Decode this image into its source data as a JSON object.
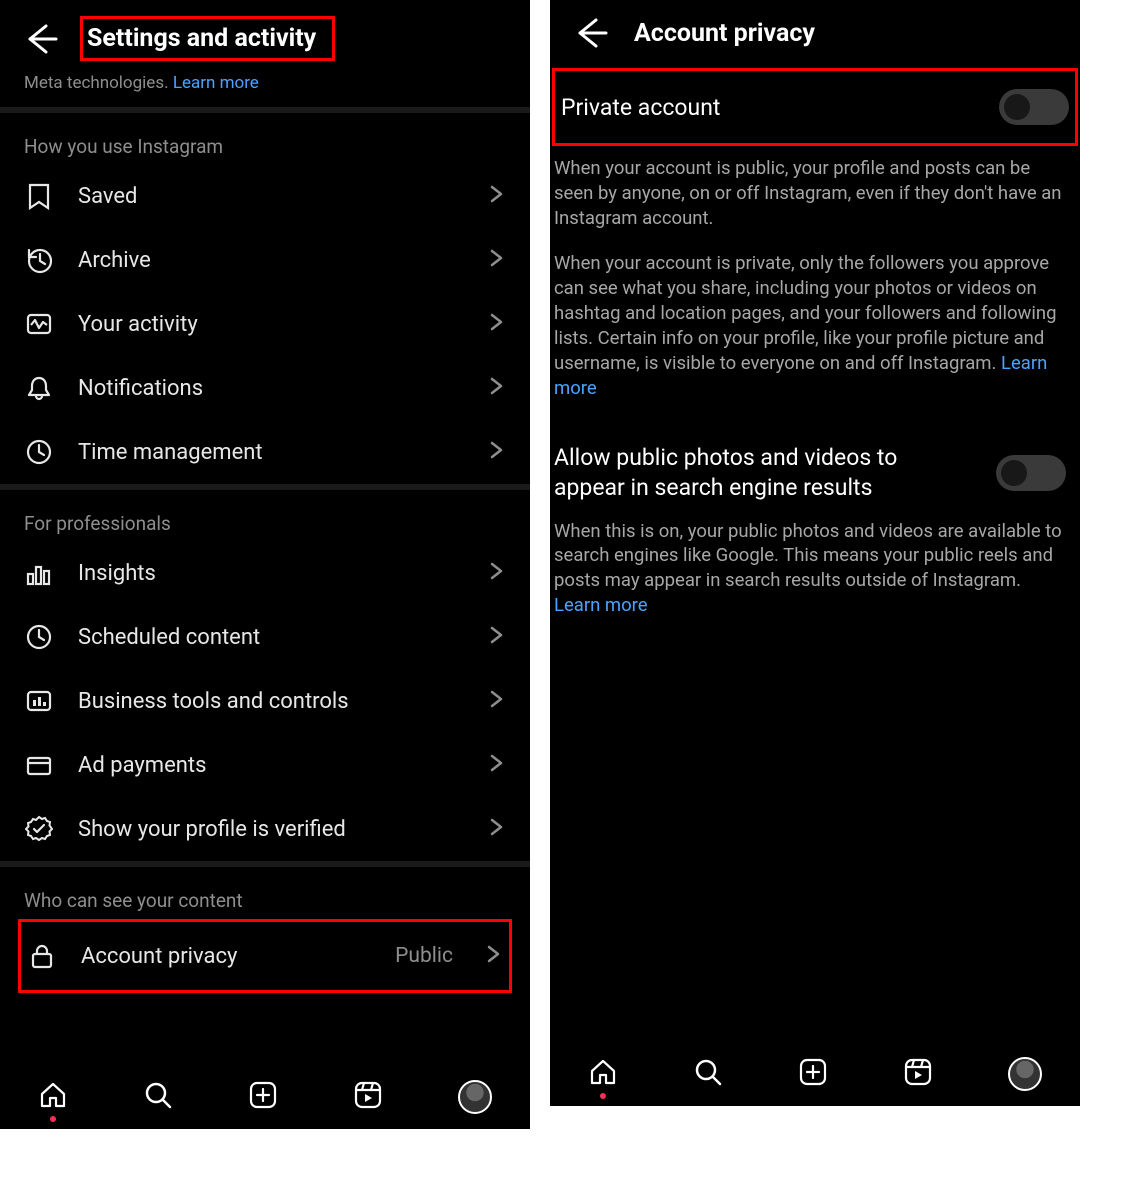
{
  "left": {
    "title": "Settings and activity",
    "meta_prefix": "Meta technologies. ",
    "meta_link": "Learn more",
    "sect_usage": "How you use Instagram",
    "rows_usage": [
      {
        "icon": "bookmark",
        "label": "Saved"
      },
      {
        "icon": "archive",
        "label": "Archive"
      },
      {
        "icon": "activity",
        "label": "Your activity"
      },
      {
        "icon": "bell",
        "label": "Notifications"
      },
      {
        "icon": "time",
        "label": "Time management"
      }
    ],
    "sect_pro": "For professionals",
    "rows_pro": [
      {
        "icon": "insights",
        "label": "Insights"
      },
      {
        "icon": "scheduled",
        "label": "Scheduled content"
      },
      {
        "icon": "biztools",
        "label": "Business tools and controls"
      },
      {
        "icon": "card",
        "label": "Ad payments"
      },
      {
        "icon": "verified",
        "label": "Show your profile is verified"
      }
    ],
    "sect_who": "Who can see your content",
    "privacy_row": {
      "icon": "lock",
      "label": "Account privacy",
      "value": "Public"
    }
  },
  "right": {
    "title": "Account privacy",
    "private_label": "Private account",
    "para1": "When your account is public, your profile and posts can be seen by anyone, on or off Instagram, even if they don't have an Instagram account.",
    "para2_prefix": "When your account is private, only the followers you approve can see what you share, including your photos or videos on hashtag and location pages, and your followers and following lists. Certain info on your profile, like your profile picture and username, is visible to everyone on and off Instagram. ",
    "para2_link": "Learn more",
    "search_label": "Allow public photos and videos to appear in search engine results",
    "para3_prefix": "When this is on, your public photos and videos are available to search engines like Google. This means your public reels and posts may appear in search results outside of Instagram. ",
    "para3_link": "Learn more"
  }
}
